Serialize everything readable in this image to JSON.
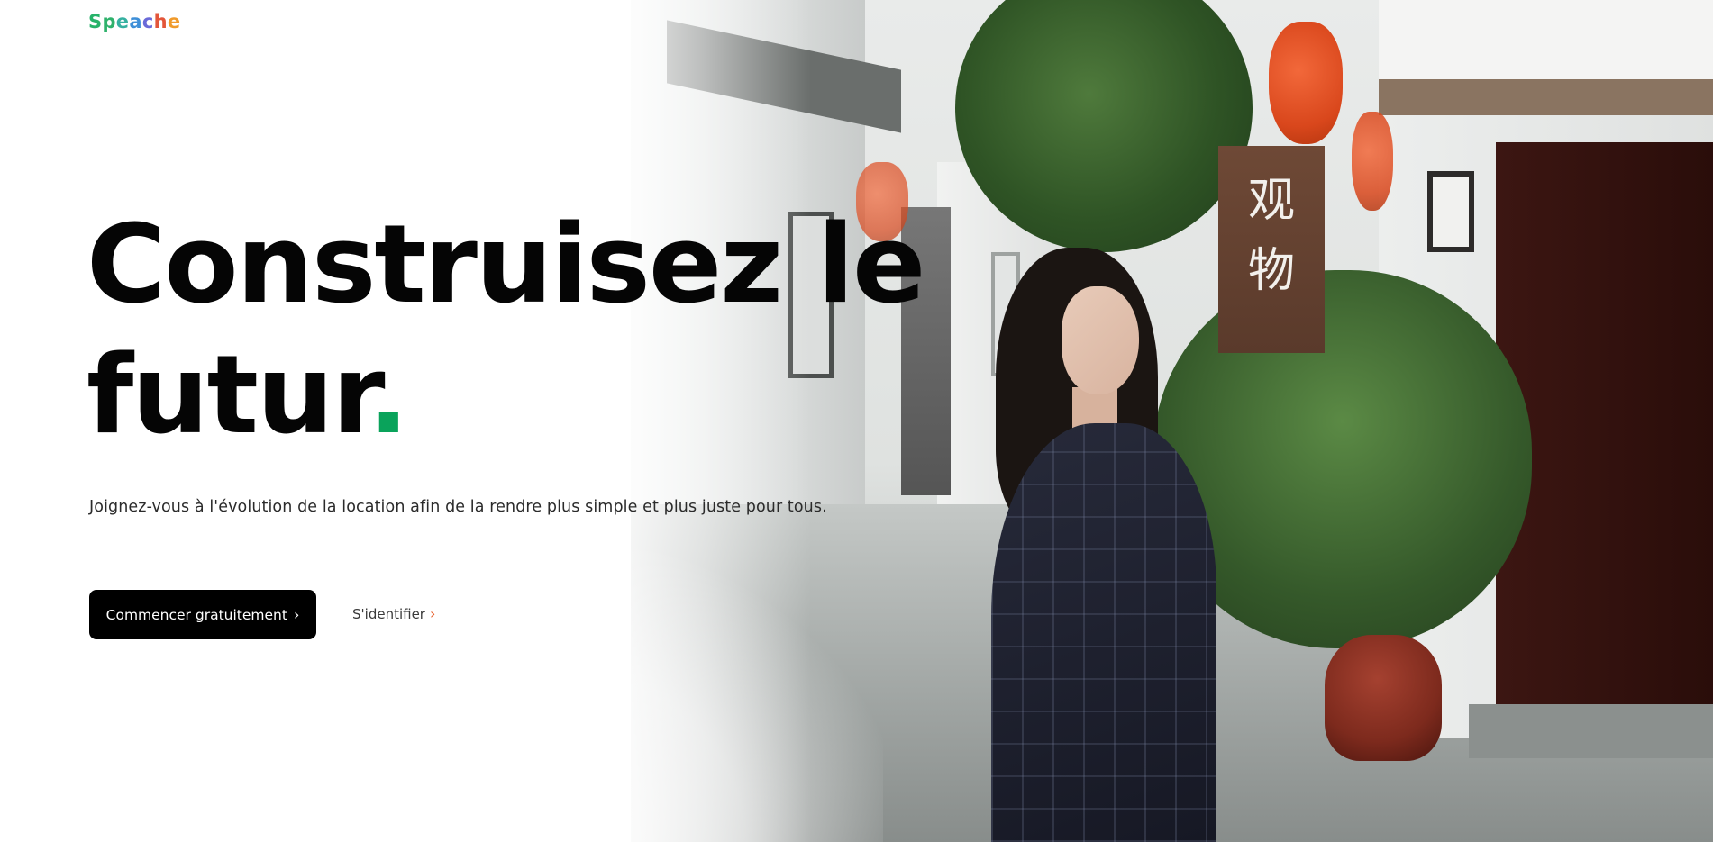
{
  "brand": {
    "name": "Speache",
    "letter_colors": [
      "#27b36a",
      "#2fb26c",
      "#35b0a0",
      "#3e8fd8",
      "#6a6ad8",
      "#e3563a",
      "#f09a2a"
    ]
  },
  "hero": {
    "title_line1": "Construisez le",
    "title_line2": "futur",
    "title_dot": ".",
    "subtitle": "Joignez-vous à l'évolution de la location afin de la rendre plus simple et plus juste pour tous.",
    "accent_color": "#0aa35b"
  },
  "actions": {
    "primary_label": "Commencer gratuitement",
    "primary_icon": "chevron-right-icon",
    "primary_chevron": "›",
    "login_label": "S'identifier",
    "login_icon": "chevron-right-icon",
    "login_chevron": "›",
    "login_chevron_color": "#e8602c"
  },
  "photo": {
    "sign_text_1": "观",
    "sign_text_2": "物"
  }
}
